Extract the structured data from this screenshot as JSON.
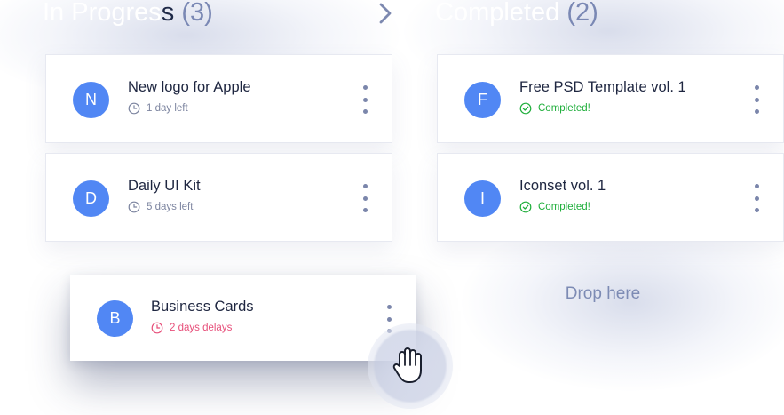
{
  "columns": [
    {
      "title_head": "In Progres",
      "title_tail": "s",
      "count": "(3)",
      "cards": [
        {
          "initial": "N",
          "title": "New logo for Apple",
          "meta": "1 day left",
          "status": "time"
        },
        {
          "initial": "D",
          "title": "Daily UI Kit",
          "meta": "5 days left",
          "status": "time"
        }
      ]
    },
    {
      "title_head": "Completed",
      "count": "(2)",
      "cards": [
        {
          "initial": "F",
          "title": "Free PSD Template vol. 1",
          "meta": "Completed!",
          "status": "done"
        },
        {
          "initial": "I",
          "title": "Iconset vol. 1",
          "meta": "Completed!",
          "status": "done"
        }
      ]
    }
  ],
  "dragged_card": {
    "initial": "B",
    "title": "Business Cards",
    "meta": "2 days delays",
    "status": "late"
  },
  "drop_zone": {
    "label": "Drop here"
  },
  "icons": {
    "next_column": "chevron-right-icon",
    "time": "clock-icon",
    "done": "check-circle-icon",
    "menu": "more-vertical-icon",
    "cursor": "grab-hand-cursor-icon"
  },
  "colors": {
    "avatar": "#5187f4",
    "completed": "#1fae3b",
    "delayed": "#e74f7a",
    "column_count": "#7a88b4",
    "drop_text": "#7d8bb4"
  }
}
